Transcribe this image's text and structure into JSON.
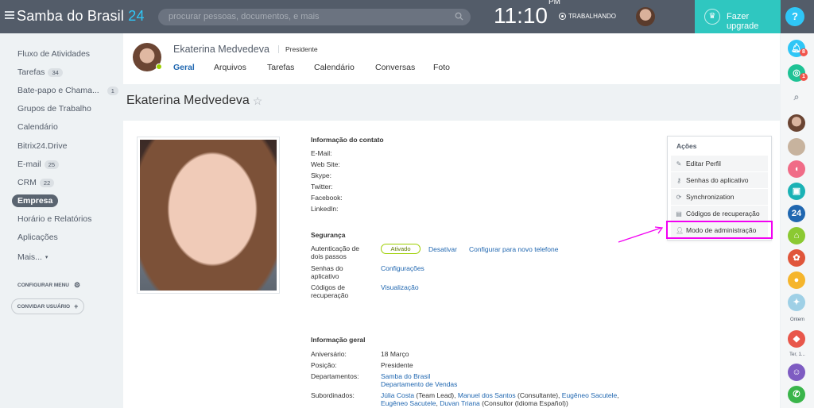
{
  "topbar": {
    "brand": "Samba do Brasil",
    "brand_num": "24",
    "search_placeholder": "procurar pessoas, documentos, e mais",
    "time": "11:10",
    "time_suffix": "PM",
    "work_status": "TRABALHANDO",
    "upgrade_label": "Fazer upgrade",
    "help_label": "?"
  },
  "leftnav": {
    "items": [
      {
        "label": "Fluxo de Atividades"
      },
      {
        "label": "Tarefas",
        "badge": "34"
      },
      {
        "label": "Bate-papo e Chama...",
        "badge": "1"
      },
      {
        "label": "Grupos de Trabalho"
      },
      {
        "label": "Calendário"
      },
      {
        "label": "Bitrix24.Drive"
      },
      {
        "label": "E-mail",
        "badge": "25"
      },
      {
        "label": "CRM",
        "badge": "22"
      },
      {
        "label": "Empresa"
      },
      {
        "label": "Horário e Relatórios"
      },
      {
        "label": "Aplicações"
      },
      {
        "label": "Mais..."
      }
    ],
    "config_menu": "CONFIGURAR MENU",
    "invite_user": "CONVIDAR USUÁRIO"
  },
  "rightbar": {
    "notif_count": "8",
    "chat_count": "1",
    "app24": "24",
    "label_ontem": "Ontem",
    "label_ter": "Ter, 1..."
  },
  "profile": {
    "name": "Ekaterina Medvedeva",
    "role": "Presidente",
    "tabs": [
      "Geral",
      "Arquivos",
      "Tarefas",
      "Calendário",
      "Conversas",
      "Foto"
    ],
    "page_title": "Ekaterina Medvedeva",
    "star": "☆"
  },
  "contact": {
    "title": "Informação do contato",
    "fields": [
      "E-Mail:",
      "Web Site:",
      "Skype:",
      "Twitter:",
      "Facebook:",
      "LinkedIn:"
    ]
  },
  "security": {
    "title": "Segurança",
    "twofa_label_1": "Autenticação de",
    "twofa_label_2": "dois passos",
    "twofa_status": "Ativado",
    "twofa_disable": "Desativar",
    "twofa_config": "Configurar para novo telefone",
    "app_pw_label_1": "Senhas do",
    "app_pw_label_2": "aplicativo",
    "app_pw_link": "Configurações",
    "rec_label_1": "Códigos de",
    "rec_label_2": "recuperação",
    "rec_link": "Visualização"
  },
  "general": {
    "title": "Informação geral",
    "birthday_label": "Aniversário:",
    "birthday_value": "18 Março",
    "position_label": "Posição:",
    "position_value": "Presidente",
    "departments_label": "Departamentos:",
    "departments": [
      "Samba do Brasil",
      "Departamento de Vendas"
    ],
    "subordinates_label": "Subordinados:",
    "sub_line1_a": "Júlia Costa",
    "sub_line1_b": " (Team Lead), ",
    "sub_line1_c": "Manuel dos Santos",
    "sub_line1_d": " (Consultante), ",
    "sub_line1_e": "Eugêneo Sacutele",
    "sub_line1_f": ",",
    "sub_line2_a": "Eugêneo Sacutele",
    "sub_line2_b": ", ",
    "sub_line2_c": "Duvan Triana",
    "sub_line2_d": " (Consultor (Idioma Español))"
  },
  "actions": {
    "title": "Ações",
    "items": [
      {
        "label": "Editar Perfil",
        "icon": "pencil-icon"
      },
      {
        "label": "Senhas do aplicativo",
        "icon": "key-icon"
      },
      {
        "label": "Synchronization",
        "icon": "sync-icon"
      },
      {
        "label": "Códigos de recuperação",
        "icon": "codes-icon"
      },
      {
        "label": "Modo de administração",
        "icon": "user-icon"
      }
    ]
  },
  "colors": {
    "topbar": "#535c69",
    "upgrade": "#2fc7c0",
    "link": "#2067b0",
    "highlight": "#f200f2"
  }
}
